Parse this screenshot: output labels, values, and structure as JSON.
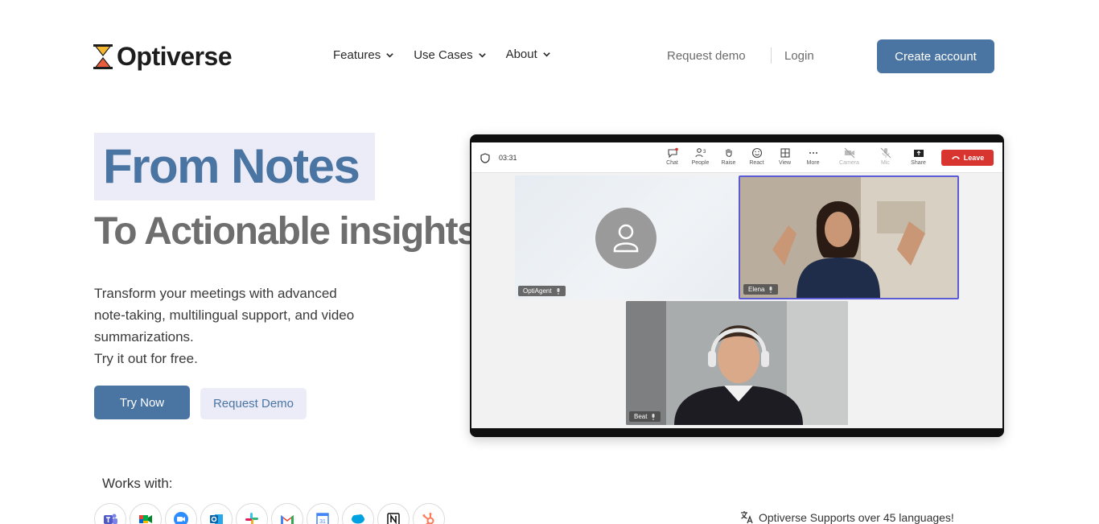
{
  "header": {
    "brand": "Optiverse",
    "nav": [
      {
        "label": "Features"
      },
      {
        "label": "Use Cases"
      },
      {
        "label": "About"
      }
    ],
    "request_demo": "Request demo",
    "login": "Login",
    "create_account": "Create account"
  },
  "hero": {
    "title": "From Notes",
    "subtitle": "To Actionable insights",
    "description": [
      "Transform your meetings with advanced",
      "note-taking, multilingual support, and video",
      "summarizations.",
      "Try it out for free."
    ],
    "try_now": "Try Now",
    "request_demo": "Request Demo"
  },
  "meeting": {
    "timer": "03:31",
    "tools": [
      "Chat",
      "People",
      "Raise",
      "React",
      "View",
      "More",
      "Camera",
      "Mic",
      "Share"
    ],
    "people_count": "3",
    "leave": "Leave",
    "participants": [
      "OptiAgent",
      "Elena",
      "Beat"
    ]
  },
  "integrations": {
    "label": "Works with:",
    "apps": [
      "teams-icon",
      "google-meet-icon",
      "zoom-icon",
      "outlook-icon",
      "slack-icon",
      "gmail-icon",
      "google-calendar-icon",
      "salesforce-icon",
      "notion-icon",
      "hubspot-icon"
    ],
    "calendar_day": "31"
  },
  "languages": {
    "note": "Optiverse Supports over 45 languages!"
  },
  "colors": {
    "accent": "#4a75a2",
    "highlight": "#ececf8",
    "leave": "#d93530"
  }
}
